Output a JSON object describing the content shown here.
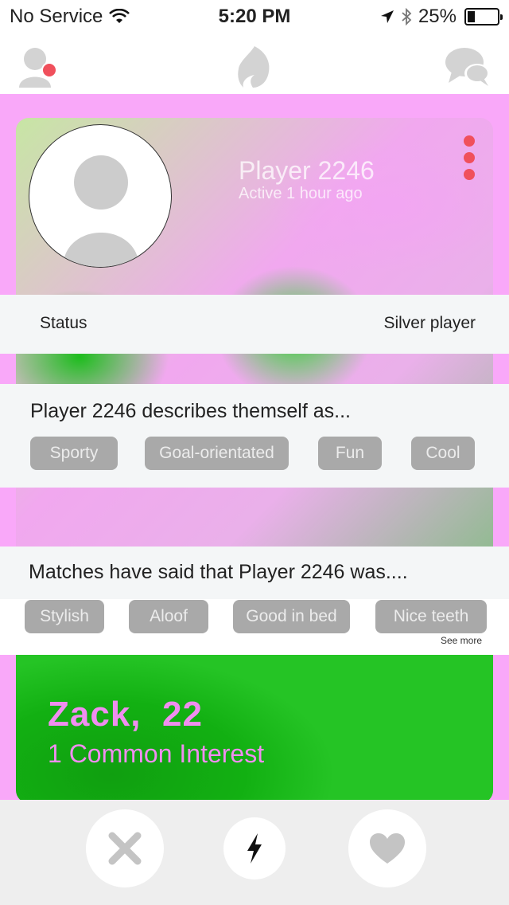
{
  "status_bar": {
    "carrier": "No Service",
    "time": "5:20 PM",
    "battery_percent": "25%",
    "battery_level": 0.25,
    "icons": [
      "wifi-icon",
      "location-arrow-icon",
      "bluetooth-icon",
      "battery-icon"
    ]
  },
  "nav": {
    "icons": [
      "profile-icon",
      "flame-icon",
      "chat-icon"
    ],
    "notification_color": "#f0505c"
  },
  "profile": {
    "name": "Player 2246",
    "active": "Active 1 hour ago"
  },
  "status": {
    "label": "Status",
    "value": "Silver player"
  },
  "describes": {
    "title": "Player 2246 describes themself as...",
    "tags": [
      "Sporty",
      "Goal-orientated",
      "Fun",
      "Cool"
    ]
  },
  "matches_said": {
    "title": "Matches have said that Player 2246 was....",
    "tags": [
      "Stylish",
      "Aloof",
      "Good in bed",
      "Nice teeth"
    ],
    "see_more": "See more"
  },
  "match": {
    "name": "Zack,",
    "age": "22",
    "interest": "1 Common Interest"
  },
  "actions": {
    "icons": [
      "close-icon",
      "lightning-icon",
      "heart-icon"
    ]
  },
  "colors": {
    "accent_pink": "#f08ef0",
    "background_pink": "#f9a8f9",
    "chip_gray": "#a9a9a9",
    "green": "#12b012"
  }
}
